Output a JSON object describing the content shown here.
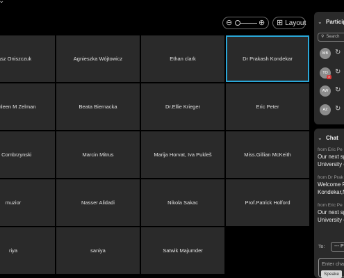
{
  "toolbar": {
    "zoom_out_icon": "zoom-out-icon",
    "zoom_in_icon": "zoom-in-icon",
    "layout_label": "Layout"
  },
  "tiles": [
    {
      "name": "nasz Oniszczuk"
    },
    {
      "name": "Agnieszka Wójtowicz"
    },
    {
      "name": "Ethan clark"
    },
    {
      "name": "Dr Prakash Kondekar",
      "active": true
    },
    {
      "name": "Kathleen M Zelman"
    },
    {
      "name": "Beata Biernacka"
    },
    {
      "name": "Dr.Ellie Krieger"
    },
    {
      "name": "Eric Peter"
    },
    {
      "name": "iej Combrzynski"
    },
    {
      "name": "Marcin Mitrus"
    },
    {
      "name": "Marija Horvat, Iva Pukleš"
    },
    {
      "name": "Miss.Gillian McKeith"
    },
    {
      "name": "muzior"
    },
    {
      "name": "Nasser Alidadi"
    },
    {
      "name": "Nikola Sakac"
    },
    {
      "name": "Prof.Patrick Holford"
    },
    {
      "name": "riya"
    },
    {
      "name": "saniya"
    },
    {
      "name": "Satwik Majumder"
    }
  ],
  "participants": {
    "title": "Particip",
    "search_placeholder": "Search",
    "items": [
      {
        "initials": "MB",
        "muted": false
      },
      {
        "initials": "TO",
        "muted": true
      },
      {
        "initials": "AW",
        "muted": false
      },
      {
        "initials": "AZ",
        "muted": false
      }
    ]
  },
  "chat": {
    "title": "Chat",
    "messages": [
      {
        "from": "from Eric Pe",
        "lines": [
          "Our next sp",
          "University o"
        ]
      },
      {
        "from": "from Dr Prak",
        "lines": [
          "Welcome R",
          "Kondekar,M"
        ]
      },
      {
        "from": "from Eric Pe",
        "lines": [
          "Our next sp",
          "University o"
        ]
      }
    ],
    "to_label": "To:",
    "to_value": "--- P",
    "input_placeholder": "Enter cha",
    "speaker_chip": "Speake"
  },
  "colors": {
    "background": "#000000",
    "tile": "#2a2a2a",
    "active_border": "#2aa7d8",
    "panel": "#2a2a2a",
    "mute_badge": "#d63a3a"
  }
}
